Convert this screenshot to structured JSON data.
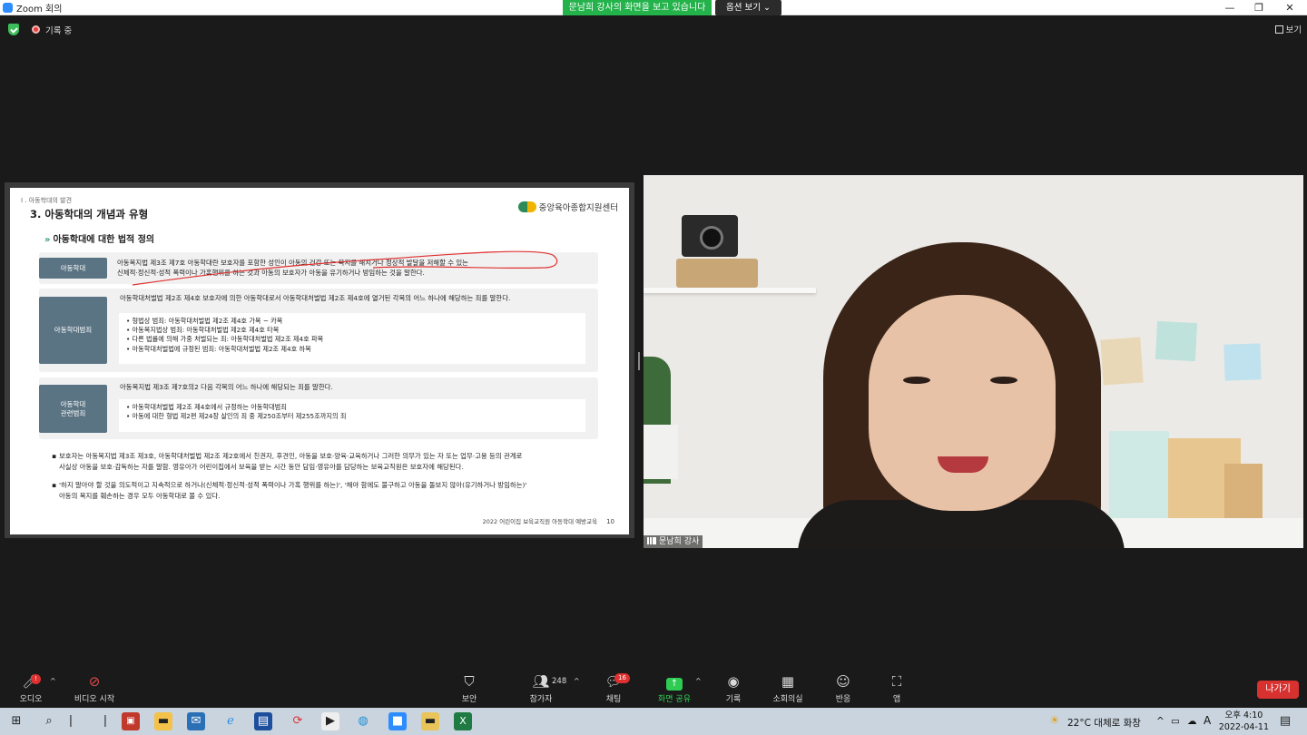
{
  "window": {
    "title": "Zoom 회의",
    "minimize": "—",
    "maximize": "❐",
    "close": "✕"
  },
  "banner": {
    "share_text": "문남희 강사의 화면을 보고 있습니다",
    "view_options": "옵션 보기 ⌄"
  },
  "status": {
    "recording": "기록 중",
    "view": "보기"
  },
  "slide": {
    "breadcrumb": "I . 아동학대의 발견",
    "title": "3. 아동학대의 개념과 유형",
    "org": "중앙육아종합지원센터",
    "section": "아동학대에 대한 법적 정의",
    "rows": [
      {
        "tag": "아동학대",
        "lines": [
          "아동복지법 제3조 제7호 아동학대란 보호자를 포함한 성인이 아동의 건강 또는 복지를 해치거나 정상적 발달을 저해할 수 있는",
          "신체적·정신적·성적 폭력이나 가혹행위를 하는 것과 아동의 보호자가 아동을 유기하거나 방임하는 것을 말한다."
        ]
      },
      {
        "tag": "아동학대범죄",
        "intro": "아동학대처벌법 제2조 제4호 보호자에 의한 아동학대로서 아동학대처벌법 제2조 제4호에 열거된 각목의 어느 하나에 해당하는 죄를 말한다.",
        "items": [
          "• 형법상 범죄: 아동학대처벌법 제2조 제4호 가목 ~ 카목",
          "• 아동복지법상 범죄: 아동학대처벌법 제2호 제4호 타목",
          "• 다른 법률에 의해 가중 처벌되는 죄: 아동학대처벌법 제2조 제4호 파목",
          "• 아동학대처벌법에 규정된 범죄: 아동학대처벌법 제2조 제4호 하목"
        ]
      },
      {
        "tag": "아동학대\n관련범죄",
        "intro": "아동복지법 제3조 제7호의2 다음 각목의 어느 하나에 해당되는 죄를 말한다.",
        "items": [
          "• 아동학대처벌법 제2조 제4호에서 규정하는 아동학대범죄",
          "• 아동에 대한 형법 제2편 제24장 살인의 죄 중 제250조부터 제255조까지의 죄"
        ]
      }
    ],
    "notes": [
      [
        "보호자는 아동복지법 제3조 제3호, 아동학대처벌법 제2조 제2호에서 친권자, 후견인, 아동을 보호·양육·교육하거나 그러한 의무가 있는 자 또는 업무·고용 등의 관계로",
        "사실상 아동을 보호·감독하는 자를 말함. 영유아가 어린이집에서 보육을 받는 시간 동안 담임·영유아를 담당하는 보육교직원은 보호자에 해당된다."
      ],
      [
        "'하지 말아야 할 것을 의도적이고 지속적으로 하거나(신체적·정신적·성적 폭력이나 가혹 행위를 하는)', '해야 함에도 불구하고 아동을 돌보지 않아(유기하거나 방임하는)'",
        "아동의 복지를 훼손하는 경우 모두 아동학대로 볼 수 있다."
      ]
    ],
    "footer": "2022 어린이집 보육교직원 아동학대 예방교육",
    "page": "10"
  },
  "video": {
    "name": "문남희 강사"
  },
  "toolbar": {
    "audio": "오디오",
    "video": "비디오 시작",
    "security": "보안",
    "participants": "참가자",
    "participants_count": "248",
    "chat": "채팅",
    "chat_badge": "16",
    "share": "화면 공유",
    "record": "기록",
    "breakout": "소회의실",
    "reactions": "반응",
    "apps": "앱",
    "leave": "나가기",
    "audio_badge": "!"
  },
  "taskbar": {
    "weather": "22°C  대체로 화창",
    "time": "오후 4:10",
    "date": "2022-04-11",
    "ime": "A"
  },
  "colors": {
    "share_green": "#24b24b",
    "leave_red": "#d7322f",
    "tag_blue": "#5b7484"
  }
}
